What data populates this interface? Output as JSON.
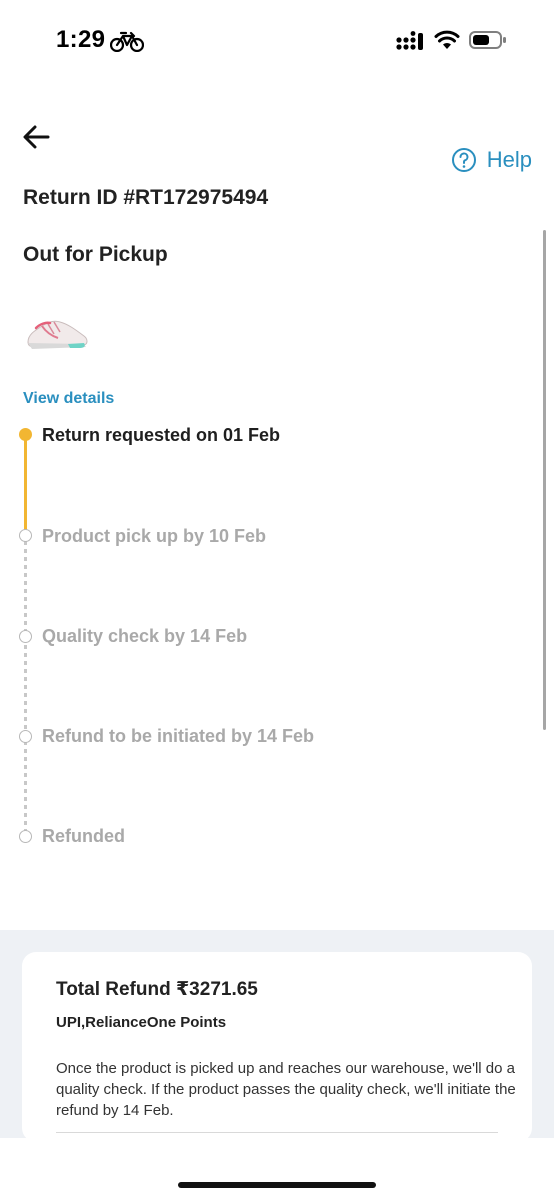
{
  "status_bar": {
    "time": "1:29",
    "icons": [
      "bicycle-icon",
      "signal-icon",
      "wifi-icon",
      "battery-icon"
    ]
  },
  "header": {
    "back_icon": "arrow-left-icon",
    "help_label": "Help",
    "help_icon": "question-circle-icon"
  },
  "return": {
    "id": "Return ID #RT172975494",
    "status": "Out for Pickup",
    "view_details": "View details"
  },
  "timeline": [
    {
      "label": "Return requested on 01 Feb",
      "done": true
    },
    {
      "label": "Product pick up by  10 Feb",
      "done": false
    },
    {
      "label": "Quality check by 14 Feb",
      "done": false
    },
    {
      "label": "Refund to be initiated by 14 Feb",
      "done": false
    },
    {
      "label": "Refunded",
      "done": false
    }
  ],
  "refund": {
    "total": "Total Refund ₹3271.65",
    "method": "UPI,RelianceOne Points",
    "note": "Once the product is picked up and reaches our warehouse, we'll do a quality check. If the product passes the quality check, we'll initiate the refund by 14 Feb."
  },
  "colors": {
    "accent": "#2a8fbf",
    "timeline_active": "#f2b632",
    "timeline_inactive": "#b8b8b8",
    "bottom_bg": "#eef1f5"
  }
}
